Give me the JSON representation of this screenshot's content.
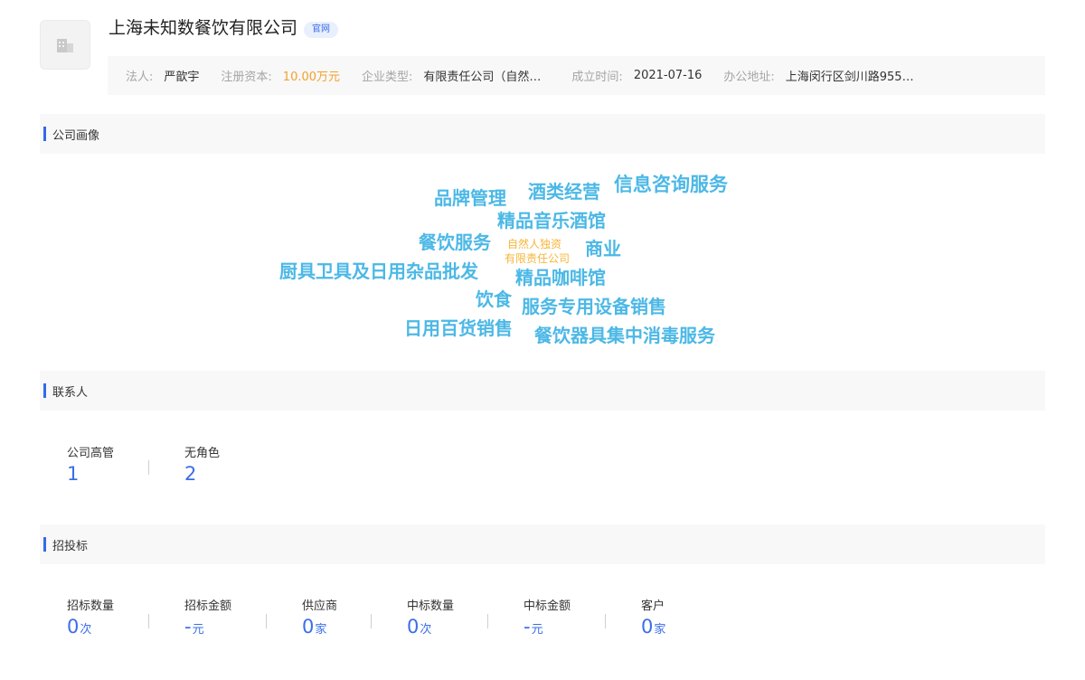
{
  "company": {
    "name": "上海未知数餐饮有限公司",
    "official_badge": "官网",
    "logo_icon": "building-icon"
  },
  "info": {
    "legal_rep_label": "法人:",
    "legal_rep_value": "严歆宇",
    "capital_label": "注册资本:",
    "capital_value": "10.00万元",
    "type_label": "企业类型:",
    "type_value": "有限责任公司（自然…",
    "founded_label": "成立时间:",
    "founded_value": "2021-07-16",
    "address_label": "办公地址:",
    "address_value": "上海闵行区剑川路955…"
  },
  "profile": {
    "title": "公司画像",
    "words": [
      "信息咨询服务",
      "酒类经营",
      "品牌管理",
      "精品音乐酒馆",
      "餐饮服务",
      "自然人独资",
      "商业",
      "有限责任公司",
      "厨具卫具及日用杂品批发",
      "精品咖啡馆",
      "饮食",
      "服务专用设备销售",
      "日用百货销售",
      "餐饮器具集中消毒服务"
    ]
  },
  "contacts": {
    "title": "联系人",
    "stats": [
      {
        "label": "公司高管",
        "value": "1"
      },
      {
        "label": "无角色",
        "value": "2"
      }
    ]
  },
  "bidding": {
    "title": "招投标",
    "stats": [
      {
        "label": "招标数量",
        "value": "0",
        "unit": "次"
      },
      {
        "label": "招标金额",
        "value": "-",
        "unit": "元"
      },
      {
        "label": "供应商",
        "value": "0",
        "unit": "家"
      },
      {
        "label": "中标数量",
        "value": "0",
        "unit": "次"
      },
      {
        "label": "中标金额",
        "value": "-",
        "unit": "元"
      },
      {
        "label": "客户",
        "value": "0",
        "unit": "家"
      }
    ]
  },
  "colors": {
    "accent": "#3569e8",
    "cloud_blue": "#4cb8e6",
    "cloud_orange": "#f5b63a",
    "capital": "#f2a12c"
  }
}
